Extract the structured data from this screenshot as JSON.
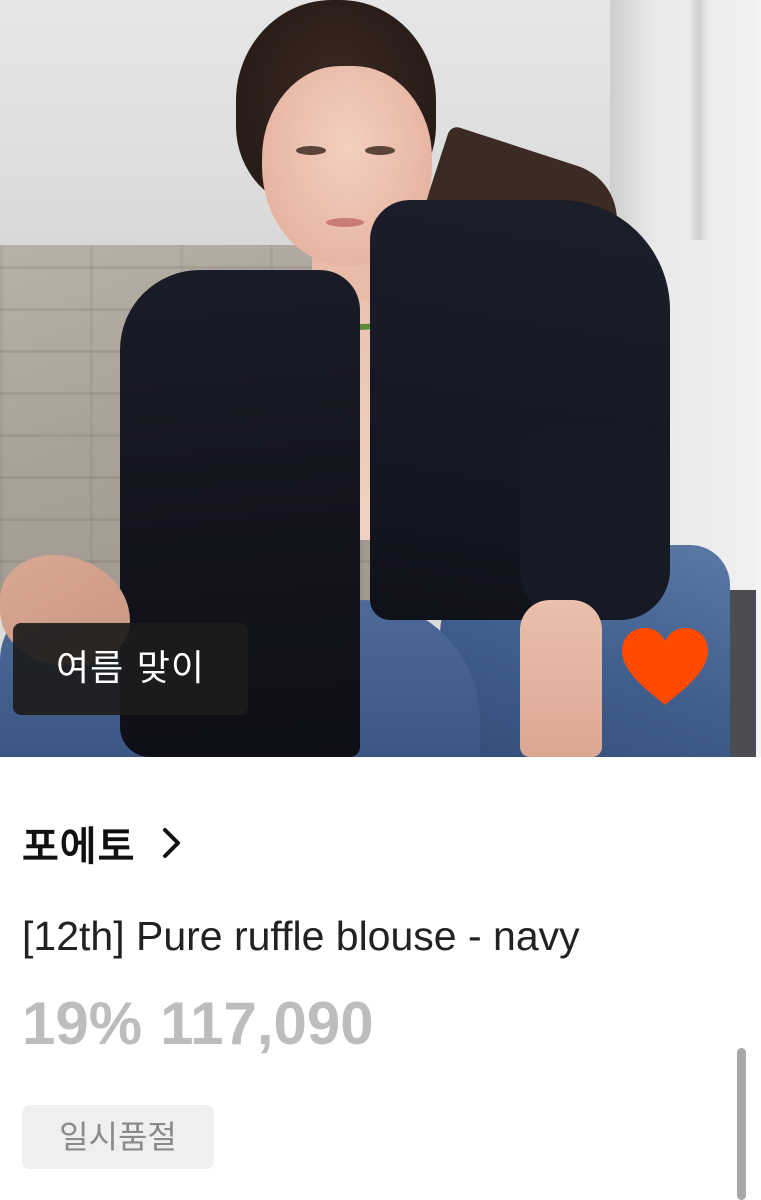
{
  "photo": {
    "tag_label": "여름 맞이",
    "like_color": "#ff4a00",
    "like_icon": "heart-icon"
  },
  "product": {
    "brand": "포에토",
    "brand_chevron_icon": "chevron-right-icon",
    "title": "[12th] Pure ruffle blouse - navy",
    "discount": "19%",
    "price": "117,090",
    "status_badge": "일시품절"
  },
  "colors": {
    "price_text": "#bdbdbd",
    "badge_bg": "#efefef",
    "badge_text": "#8a8a8a",
    "tag_bg": "#1c1c1c"
  }
}
